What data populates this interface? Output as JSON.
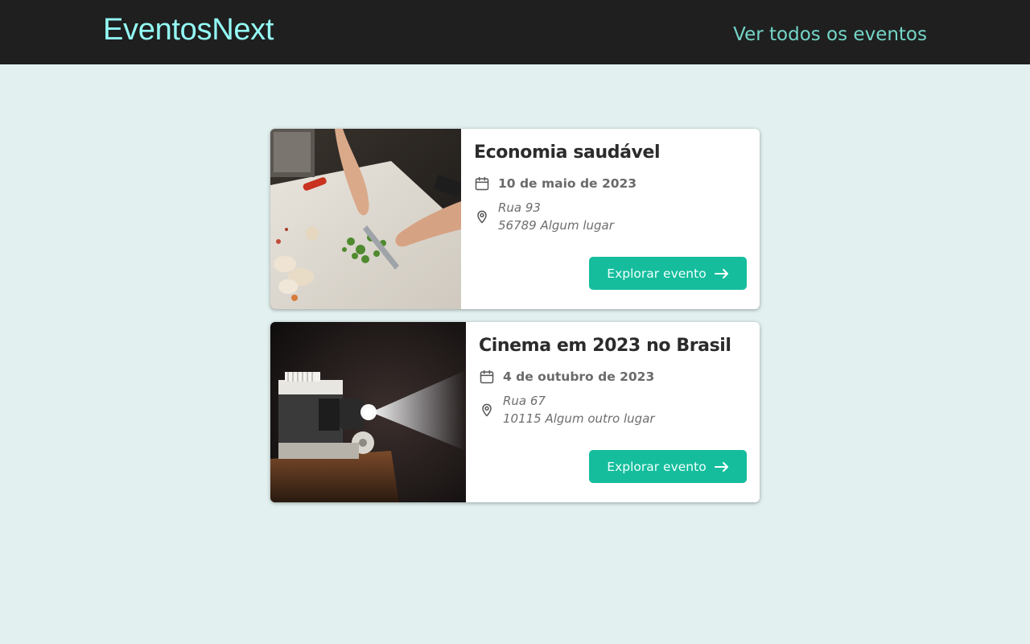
{
  "header": {
    "logo": "EventosNext",
    "nav_link": "Ver todos os eventos"
  },
  "events": [
    {
      "title": "Economia saudável",
      "date": "10 de maio de 2023",
      "address_line1": "Rua 93",
      "address_line2": "56789 Algum lugar",
      "button_label": "Explorar evento",
      "image_subject": "cooking-chopping-vegetables"
    },
    {
      "title": "Cinema em 2023 no Brasil",
      "date": "4 de outubro de 2023",
      "address_line1": "Rua 67",
      "address_line2": "10115 Algum outro lugar",
      "button_label": "Explorar evento",
      "image_subject": "film-projector"
    }
  ],
  "colors": {
    "header_bg": "#1f1f1f",
    "logo": "#94fbf5",
    "nav_link": "#74d6c8",
    "page_bg": "#e2f0f0",
    "button_bg": "#15bd9d"
  }
}
